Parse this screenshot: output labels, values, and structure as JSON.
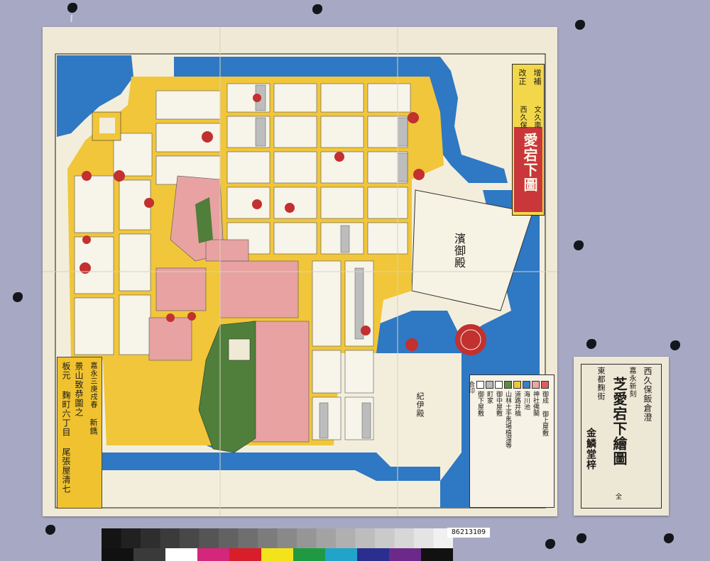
{
  "image_id_label": "86213109",
  "map": {
    "title_cartouche": {
      "line1": "增補",
      "line2": "改正",
      "line3": "文久南",
      "line4": "西久保",
      "title": "愛宕下圖"
    },
    "publisher_panel": {
      "date": "嘉永三庚戌春",
      "new_edition": "新鐫",
      "author": "景山致恭圖之",
      "publisher": "板元 麴町六丁目 尾張屋清七"
    },
    "labels": {
      "palace": "濱御殿",
      "kii": "紀伊殿"
    },
    "legend": {
      "items": [
        {
          "text": "御成 御上屋敷",
          "color": "#e05d5d"
        },
        {
          "text": "神社佛閣",
          "color": "#e8a7a7"
        },
        {
          "text": "海川池",
          "color": "#3a7fc6"
        },
        {
          "text": "道路并橋",
          "color": "#e9c93e"
        },
        {
          "text": "山林土手馬場植溜等",
          "color": "#5d8b45"
        },
        {
          "text": "御中屋敷",
          "color": "#ffffff"
        },
        {
          "text": "町家",
          "color": "#b9b9b9"
        },
        {
          "text": "御下屋敷",
          "color": "#ffffff"
        },
        {
          "text": "合印",
          "color": ""
        }
      ]
    },
    "colors": {
      "water": "#2f78c3",
      "road": "#efc93c",
      "temple": "#e8a2a2",
      "town": "#bdbdbd",
      "paper": "#efe9d5",
      "red": "#c2302f"
    }
  },
  "ticket": {
    "line1": "西久保飯倉澄",
    "line2": "嘉永新刻",
    "title": "芝愛宕下繪圖",
    "line4": "東都麴街",
    "publisher": "金鱗堂梓",
    "volume": "全"
  },
  "color_bar": {
    "swatches": [
      "#111111",
      "#3a3a3a",
      "#ffffff",
      "#d4267a",
      "#d81e2a",
      "#f2e31a",
      "#1f9a43",
      "#22a3c9",
      "#2a2f8f",
      "#6b2a8a",
      "#111111"
    ]
  }
}
